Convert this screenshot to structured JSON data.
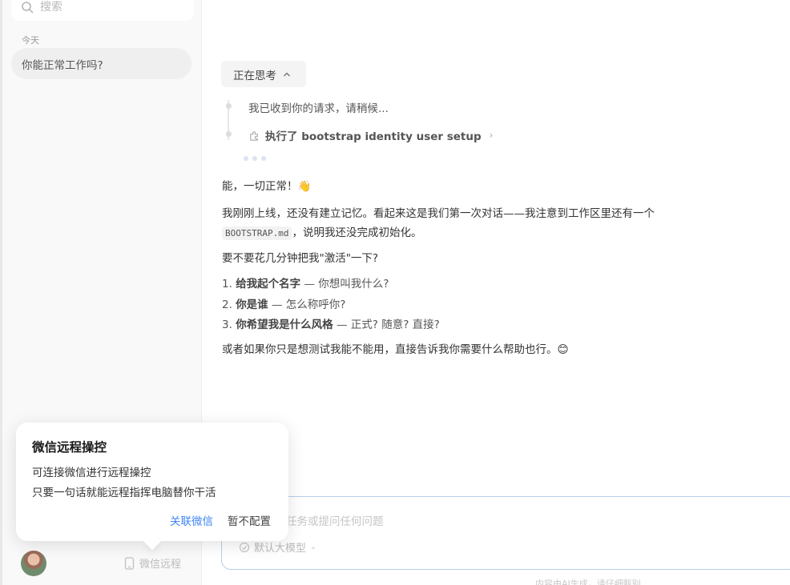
{
  "sidebar": {
    "search_placeholder": "搜索",
    "section_today": "今天",
    "chat_item": "你能正常工作吗?",
    "remote_label": "微信远程"
  },
  "thinking": {
    "label": "正在思考",
    "step1": "我已收到你的请求，请稍候...",
    "step2": "执行了 bootstrap identity user setup"
  },
  "message": {
    "line1": "能，一切正常！👋",
    "line2_a": "我刚刚上线，还没有建立记忆。看起来这是我们第一次对话——我注意到工作区里还有一个",
    "code": "BOOTSTRAP.md",
    "line2_b": "，说明我还没完成初始化。",
    "line3": "要不要花几分钟把我\"激活\"一下?",
    "items": [
      {
        "num": "1.",
        "bold": "给我起个名字",
        "rest": " — 你想叫我什么?"
      },
      {
        "num": "2.",
        "bold": "你是谁",
        "rest": " — 怎么称呼你?"
      },
      {
        "num": "3.",
        "bold": "你希望我是什么风格",
        "rest": " — 正式? 随意? 直接?"
      }
    ],
    "closing": "或者如果你只是想测试我能不能用，直接告诉我你需要什么帮助也行。😊"
  },
  "input": {
    "placeholder": "任务或提问任何问题",
    "model_label": "默认大模型"
  },
  "disclaimer": "内容由AI生成，请仔细甄别",
  "popover": {
    "title": "微信远程操控",
    "line1": "可连接微信进行远程操控",
    "line2": "只要一句话就能远程指挥电脑替你干活",
    "link_button": "关联微信",
    "skip_button": "暂不配置"
  },
  "colors": {
    "accent": "#3d85f5",
    "input_border": "#b9cdea"
  }
}
